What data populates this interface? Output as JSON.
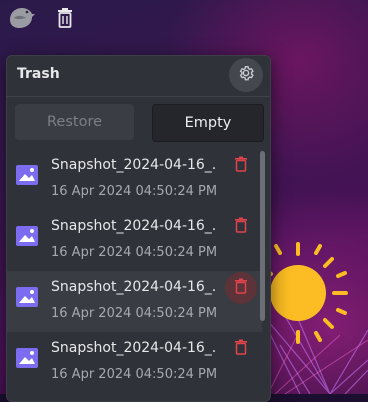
{
  "popup": {
    "title": "Trash",
    "restore_label": "Restore",
    "empty_label": "Empty"
  },
  "items": [
    {
      "name": "Snapshot_2024-04-16_...",
      "date": "16 Apr 2024 04:50:24 PM"
    },
    {
      "name": "Snapshot_2024-04-16_...",
      "date": "16 Apr 2024 04:50:24 PM"
    },
    {
      "name": "Snapshot_2024-04-16_...",
      "date": "16 Apr 2024 04:50:24 PM"
    },
    {
      "name": "Snapshot_2024-04-16_...",
      "date": "16 Apr 2024 04:50:24 PM"
    }
  ],
  "icons": {
    "app_icon": "bird-icon",
    "panel_icon": "trash-icon",
    "settings_icon": "gear-icon",
    "item_icon": "image-icon",
    "delete_icon": "trash-icon"
  },
  "colors": {
    "accent_image": "#7b6cf0",
    "delete_red": "#e0434b",
    "sun": "#fbbd23"
  }
}
